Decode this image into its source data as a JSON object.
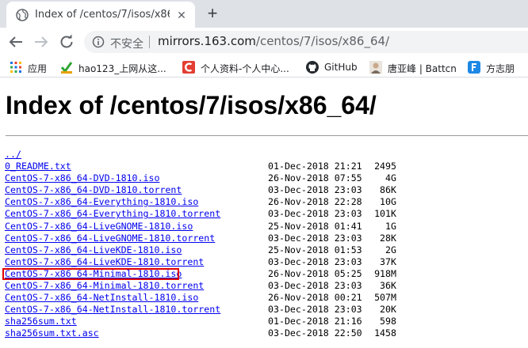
{
  "tab": {
    "title": "Index of /centos/7/isos/x86_64/",
    "close_glyph": "✕",
    "new_tab_glyph": "+"
  },
  "omnibox": {
    "security_label": "不安全",
    "url_host": "mirrors.163.com",
    "url_path": "/centos/7/isos/x86_64/"
  },
  "bookmarks": [
    {
      "label": "应用",
      "icon": "apps-grid-icon"
    },
    {
      "label": "hao123_上网从这...",
      "icon": "hao123-icon"
    },
    {
      "label": "个人资料-个人中心...",
      "icon": "csdn-icon"
    },
    {
      "label": "GitHub",
      "icon": "github-icon"
    },
    {
      "label": "唐亚峰 | Battcn",
      "icon": "avatar-icon"
    },
    {
      "label": "方志朋",
      "icon": "f-logo-icon"
    }
  ],
  "page": {
    "title": "Index of /centos/7/isos/x86_64/",
    "highlighted_index": 9,
    "entries": [
      {
        "name": "../",
        "date": "",
        "size": ""
      },
      {
        "name": "0_README.txt",
        "date": "01-Dec-2018 21:21",
        "size": "2495"
      },
      {
        "name": "CentOS-7-x86_64-DVD-1810.iso",
        "date": "26-Nov-2018 07:55",
        "size": "4G"
      },
      {
        "name": "CentOS-7-x86_64-DVD-1810.torrent",
        "date": "03-Dec-2018 23:03",
        "size": "86K"
      },
      {
        "name": "CentOS-7-x86_64-Everything-1810.iso",
        "date": "26-Nov-2018 22:28",
        "size": "10G"
      },
      {
        "name": "CentOS-7-x86_64-Everything-1810.torrent",
        "date": "03-Dec-2018 23:03",
        "size": "101K"
      },
      {
        "name": "CentOS-7-x86_64-LiveGNOME-1810.iso",
        "date": "25-Nov-2018 01:41",
        "size": "1G"
      },
      {
        "name": "CentOS-7-x86_64-LiveGNOME-1810.torrent",
        "date": "03-Dec-2018 23:03",
        "size": "28K"
      },
      {
        "name": "CentOS-7-x86_64-LiveKDE-1810.iso",
        "date": "25-Nov-2018 01:53",
        "size": "2G"
      },
      {
        "name": "CentOS-7-x86_64-LiveKDE-1810.torrent",
        "date": "03-Dec-2018 23:03",
        "size": "37K"
      },
      {
        "name": "CentOS-7-x86_64-Minimal-1810.iso",
        "date": "26-Nov-2018 05:25",
        "size": "918M"
      },
      {
        "name": "CentOS-7-x86_64-Minimal-1810.torrent",
        "date": "03-Dec-2018 23:03",
        "size": "36K"
      },
      {
        "name": "CentOS-7-x86_64-NetInstall-1810.iso",
        "date": "26-Nov-2018 00:21",
        "size": "507M"
      },
      {
        "name": "CentOS-7-x86_64-NetInstall-1810.torrent",
        "date": "03-Dec-2018 23:03",
        "size": "20K"
      },
      {
        "name": "sha256sum.txt",
        "date": "01-Dec-2018 21:16",
        "size": "598"
      },
      {
        "name": "sha256sum.txt.asc",
        "date": "03-Dec-2018 22:50",
        "size": "1458"
      }
    ]
  },
  "colors": {
    "link": "#0000ee",
    "highlight_box": "#e00000",
    "tabstrip": "#dee1e6",
    "omnibox": "#f1f3f4"
  }
}
